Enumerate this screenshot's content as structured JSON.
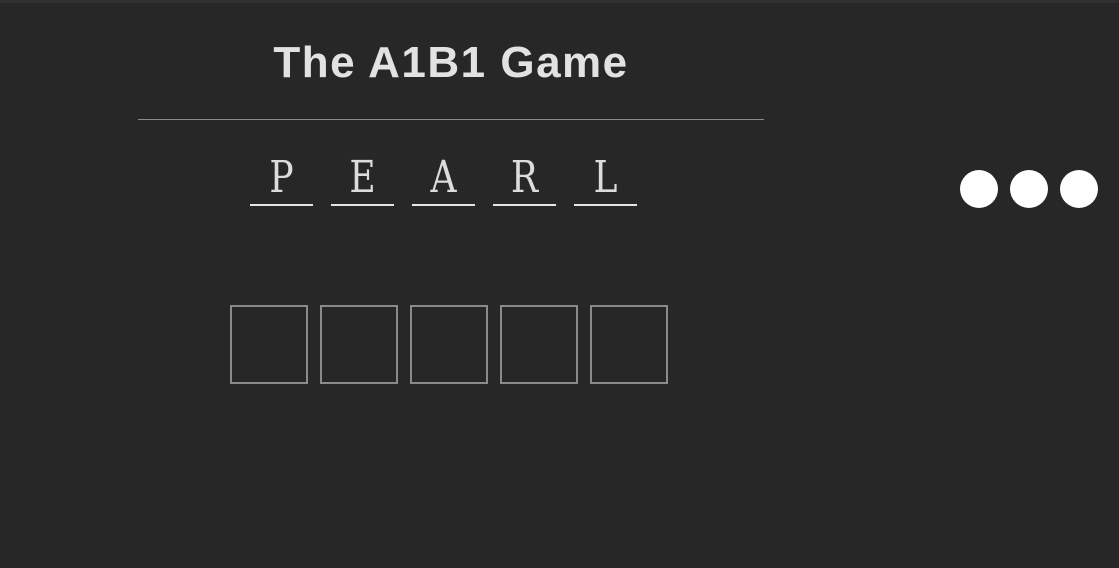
{
  "header": {
    "title": "The A1B1 Game"
  },
  "word": {
    "letters": [
      "P",
      "E",
      "A",
      "R",
      "L"
    ]
  },
  "menu": {
    "icon": "more-dots-icon"
  },
  "guess": {
    "values": [
      "",
      "",
      "",
      "",
      ""
    ]
  },
  "colors": {
    "background": "#272727",
    "text": "#e2e2e2",
    "box_border": "#8a8a8a",
    "dots": "#ffffff"
  }
}
